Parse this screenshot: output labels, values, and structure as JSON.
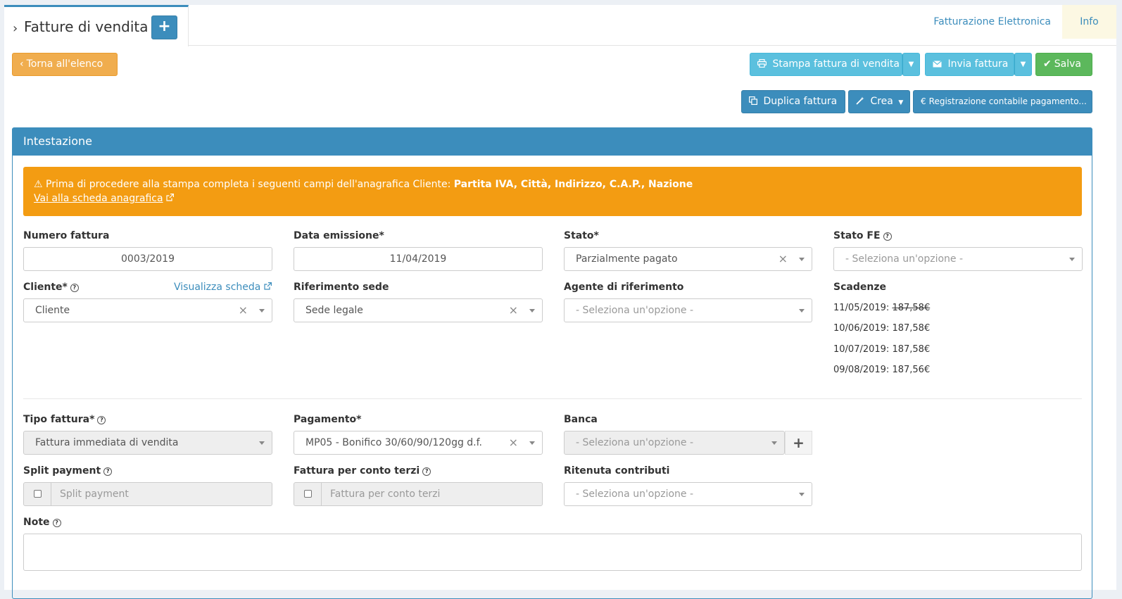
{
  "header": {
    "title": "Fatture di vendita",
    "add_label": "+",
    "tabs": [
      {
        "label": "Fatturazione Elettronica"
      },
      {
        "label": "Info"
      }
    ]
  },
  "toolbar": {
    "back_label": "Torna all'elenco",
    "print_label": "Stampa fattura di vendita",
    "send_label": "Invia fattura",
    "save_label": "Salva",
    "duplicate_label": "Duplica fattura",
    "create_label": "Crea",
    "register_label": "Registrazione contabile pagamento..."
  },
  "panel": {
    "title": "Intestazione",
    "alert": {
      "text": "Prima di procedere alla stampa completa i seguenti campi dell'anagrafica Cliente: ",
      "fields": "Partita IVA, Città, Indirizzo, C.A.P., Nazione",
      "link": "Vai alla scheda anagrafica"
    }
  },
  "form": {
    "numero_fattura": {
      "label": "Numero fattura",
      "value": "0003/2019"
    },
    "data_emissione": {
      "label": "Data emissione*",
      "value": "11/04/2019"
    },
    "stato": {
      "label": "Stato*",
      "value": "Parzialmente pagato"
    },
    "stato_fe": {
      "label": "Stato FE",
      "placeholder": "- Seleziona un'opzione -"
    },
    "cliente": {
      "label": "Cliente*",
      "value": "Cliente",
      "link": "Visualizza scheda"
    },
    "riferimento_sede": {
      "label": "Riferimento sede",
      "value": "Sede legale"
    },
    "agente": {
      "label": "Agente di riferimento",
      "placeholder": "- Seleziona un'opzione -"
    },
    "scadenze": {
      "label": "Scadenze",
      "items": [
        {
          "date": "11/05/2019:",
          "amount": "187,58€",
          "struck": true
        },
        {
          "date": "10/06/2019:",
          "amount": "187,58€",
          "struck": false
        },
        {
          "date": "10/07/2019:",
          "amount": "187,58€",
          "struck": false
        },
        {
          "date": "09/08/2019:",
          "amount": "187,56€",
          "struck": false
        }
      ]
    },
    "tipo_fattura": {
      "label": "Tipo fattura*",
      "value": "Fattura immediata di vendita"
    },
    "pagamento": {
      "label": "Pagamento*",
      "value": "MP05 - Bonifico 30/60/90/120gg d.f."
    },
    "banca": {
      "label": "Banca",
      "placeholder": "- Seleziona un'opzione -"
    },
    "split_payment": {
      "label": "Split payment",
      "placeholder": "Split payment"
    },
    "conto_terzi": {
      "label": "Fattura per conto terzi",
      "placeholder": "Fattura per conto terzi"
    },
    "ritenuta": {
      "label": "Ritenuta contributi",
      "placeholder": "- Seleziona un'opzione -"
    },
    "note": {
      "label": "Note"
    }
  },
  "colors": {
    "primary": "#3c8dbc",
    "warning_button": "#f0ad4e",
    "alert": "#f39c12",
    "info": "#5bc0de",
    "success": "#5cb85c"
  }
}
